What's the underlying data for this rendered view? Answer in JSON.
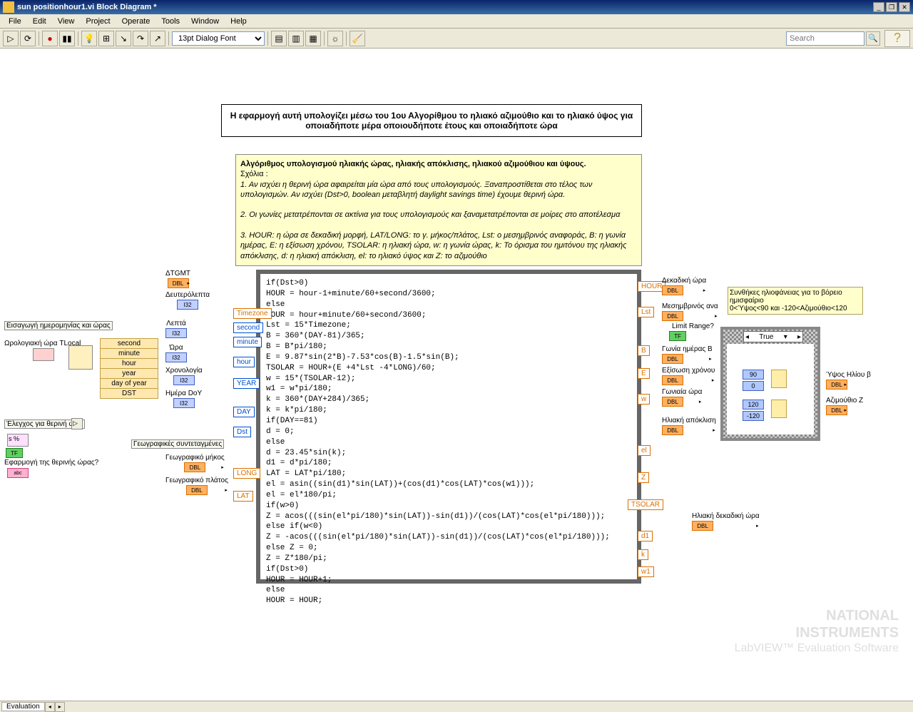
{
  "window": {
    "title": "sun positionhour1.vi Block Diagram *"
  },
  "menu": {
    "file": "File",
    "edit": "Edit",
    "view": "View",
    "project": "Project",
    "operate": "Operate",
    "tools": "Tools",
    "window": "Window",
    "help": "Help"
  },
  "toolbar": {
    "font": "13pt Dialog Font",
    "search_placeholder": "Search"
  },
  "top_comment": "Η εφαρμογή αυτή υπολογίζει μέσω του 1ου Αλγορίθμου το ηλιακό αζιμούθιο και το ηλιακό ύψος για οποιαδήποτε μέρα οποιουδήποτε έτους και οποιαδήποτε ώρα",
  "algo": {
    "title": "Αλγόριθμος υπολογισμού ηλιακής ώρας, ηλιακής απόκλισης, ηλιακού αζιμούθιου και ύψους.",
    "sxolia": "Σχόλια :",
    "p1": "1. Αν ισχύει η θερινή ώρα αφαιρείται μία ώρα από τους υπολογισμούς. Ξαναπροστίθεται στο τέλος των υπολογισμών. Αν ισχύει (Dst>0, boolean μεταβλητή daylight savings time) έχουμε θερινή ώρα.",
    "p2": "2. Οι γωνίες μετατρέπονται σε ακτίνια για τους υπολογισμούς και ξαναμετατρέπονται σε μοίρες στο αποτέλεσμα",
    "p3": "3. HOUR: η ώρα σε δεκαδική μορφή, LAT/LONG: το γ. μήκος/πλάτος, Lst: ο μεσημβρινός αναφοράς, B: η γωνία ημέρας, E: η εξίσωση χρόνου, TSOLAR: η ηλιακή ώρα, w: η γωνία ώρας, k: Το όρισμα του ημιτόνου της ηλιακής απόκλισης, d: η ηλιακή απόκλιση,  el: το ηλιακό ύψος και Z: το αζιμούθιο"
  },
  "formula_code": "if(Dst>0)\nHOUR = hour-1+minute/60+second/3600;\nelse\nHOUR = hour+minute/60+second/3600;\nLst = 15*Timezone;\nB = 360*(DAY-81)/365;\nB = B*pi/180;\nE = 9.87*sin(2*B)-7.53*cos(B)-1.5*sin(B);\nTSOLAR = HOUR+(E +4*Lst -4*LONG)/60;\nw = 15*(TSOLAR-12);\nw1 = w*pi/180;\nk = 360*(DAY+284)/365;\nk = k*pi/180;\nif(DAY==81)\nd = 0;\nelse\nd = 23.45*sin(k);\nd1 = d*pi/180;\nLAT = LAT*pi/180;\nel = asin((sin(d1)*sin(LAT))+(cos(d1)*cos(LAT)*cos(w1)));\nel = el*180/pi;\nif(w>0)\nZ = acos(((sin(el*pi/180)*sin(LAT))-sin(d1))/(cos(LAT)*cos(el*pi/180)));\nelse if(w<0)\nZ = -acos(((sin(el*pi/180)*sin(LAT))-sin(d1))/(cos(LAT)*cos(el*pi/180)));\nelse Z = 0;\nZ = Z*180/pi;\nif(Dst>0)\nHOUR = HOUR+1;\nelse\nHOUR = HOUR;",
  "tunnels_left": {
    "timezone": "Timezone",
    "second": "second",
    "minute": "minute",
    "hour": "hour",
    "year": "YEAR",
    "day": "DAY",
    "dst": "Dst",
    "long": "LONG",
    "lat": "LAT"
  },
  "tunnels_right": {
    "hour": "HOUR",
    "lst": "Lst",
    "b": "B",
    "e": "E",
    "w": "w",
    "el": "el",
    "z": "Z",
    "tsolar": "TSOLAR",
    "d1": "d1",
    "k": "k",
    "w1": "w1"
  },
  "left_terms": {
    "dtgmt": "ΔTGMT",
    "deps": "Δευτερόλεπτα",
    "lepta": "Λεπτά",
    "ora": "Ώρα",
    "xrono": "Χρονολογία",
    "doy": "Ημέρα DoY",
    "gmhkos": "Γεωγραφικό μήκος",
    "gplatos": "Γεωγραφικό πλάτος",
    "eisag": "Εισαγωγή  ημερομηνίας και ώρας",
    "tlocal": "Ωρολογιακή ώρα TLocal",
    "elenxos": "Έλεγχος για θερινή ώρα",
    "efarmogi": "Εφαρμογή της θερινής ώρας?",
    "geosynt": "Γεωγραφικές συντεταγμένες",
    "dbl": "DBL",
    "i32": "I32",
    "tf": "TF",
    "abc": "abc"
  },
  "unbundle": {
    "second": "second",
    "minute": "minute",
    "hour": "hour",
    "year": "year",
    "doy": "day of year",
    "dst": "DST"
  },
  "right_terms": {
    "dekora": "Δεκαδική ώρα",
    "mesim": "Μεσημβρινός ανα",
    "limit": "Limit Range?",
    "gonb": "Γωνία ημέρας Β",
    "eksxr": "Εξίσωση χρόνου",
    "gonora": "Γωνιαία ώρα",
    "apokl": "Ηλιακή απόκλιση",
    "hldekora": "Ηλιακή δεκαδική ώρα",
    "synth": "Συνθήκες ηλιοφάνειας για το βόρειο ημισφαίριο\n0<Ύψος<90 και -120<Αζιμούθιο<120",
    "ypsos": "Ύψος Ηλίου β",
    "azim": "Αζιμούθιο Ζ"
  },
  "case": {
    "selector": "True",
    "n90": "90",
    "n0": "0",
    "n120": "120",
    "nm120": "-120"
  },
  "watermark": {
    "l1": "NATIONAL",
    "l2": "INSTRUMENTS",
    "l3": "LabVIEW™ Evaluation Software"
  },
  "status": {
    "tab": "Evaluation"
  }
}
